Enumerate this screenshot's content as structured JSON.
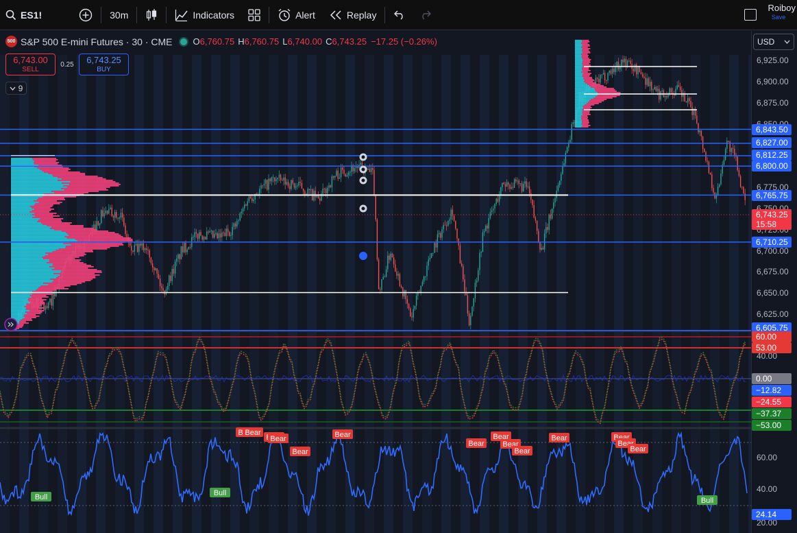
{
  "toolbar": {
    "symbol": "ES1!",
    "interval": "30m",
    "indicators_label": "Indicators",
    "alert_label": "Alert",
    "replay_label": "Replay",
    "user_name": "Roiboy",
    "save_label": "Save"
  },
  "legend": {
    "badge": "500",
    "title": "S&P 500 E-mini Futures · 30 · CME",
    "open_k": "O",
    "open_v": "6,760.75",
    "high_k": "H",
    "high_v": "6,760.75",
    "low_k": "L",
    "low_v": "6,740.00",
    "close_k": "C",
    "close_v": "6,743.25",
    "change": "−17.25 (−0.26%)"
  },
  "trade": {
    "sell_price": "6,743.00",
    "sell_label": "SELL",
    "spread": "0.25",
    "buy_price": "6,743.25",
    "buy_label": "BUY",
    "indicator_count": "9"
  },
  "axis": {
    "currency": "USD",
    "price_ticks": [
      "6,925.00",
      "6,900.00",
      "6,875.00",
      "6,850.00",
      "6,825.00",
      "6,800.00",
      "6,775.00",
      "6,750.00",
      "6,725.00",
      "6,700.00",
      "6,675.00",
      "6,650.00",
      "6,625.00"
    ],
    "level_labels": [
      {
        "text": "6,843.50",
        "color": "#2962ff"
      },
      {
        "text": "6,827.00",
        "color": "#2962ff"
      },
      {
        "text": "6,812.25",
        "color": "#2962ff"
      },
      {
        "text": "6,800.00",
        "color": "#2962ff"
      },
      {
        "text": "6,765.75",
        "color": "#2962ff"
      },
      {
        "text": "6,710.25",
        "color": "#2962ff"
      },
      {
        "text": "6,605.75",
        "color": "#2962ff"
      }
    ],
    "current_price": "6,743.25",
    "countdown": "15:58",
    "osc_ticks": [
      "40.00"
    ],
    "osc_labels": [
      {
        "text": "60.00",
        "color": "#e53935"
      },
      {
        "text": "53.00",
        "color": "#e53935"
      },
      {
        "text": "0.00",
        "color": "#787b86"
      },
      {
        "text": "−12.82",
        "color": "#2962ff"
      },
      {
        "text": "−24.55",
        "color": "#f23645"
      },
      {
        "text": "−37.37",
        "color": "#1b7f2a"
      },
      {
        "text": "−53.00",
        "color": "#1b7f2a"
      }
    ],
    "rsi_ticks": [
      "60.00",
      "40.00",
      "20.00"
    ],
    "rsi_current": "24.14"
  },
  "signals": {
    "bear_label": "Bear",
    "bull_label": "Bull"
  },
  "colors": {
    "up": "#26a69a",
    "down": "#ef5350",
    "blue": "#2962ff",
    "vp_up": "#26c6da",
    "vp_down": "#f0407a",
    "rsi": "#2f6bff"
  }
}
